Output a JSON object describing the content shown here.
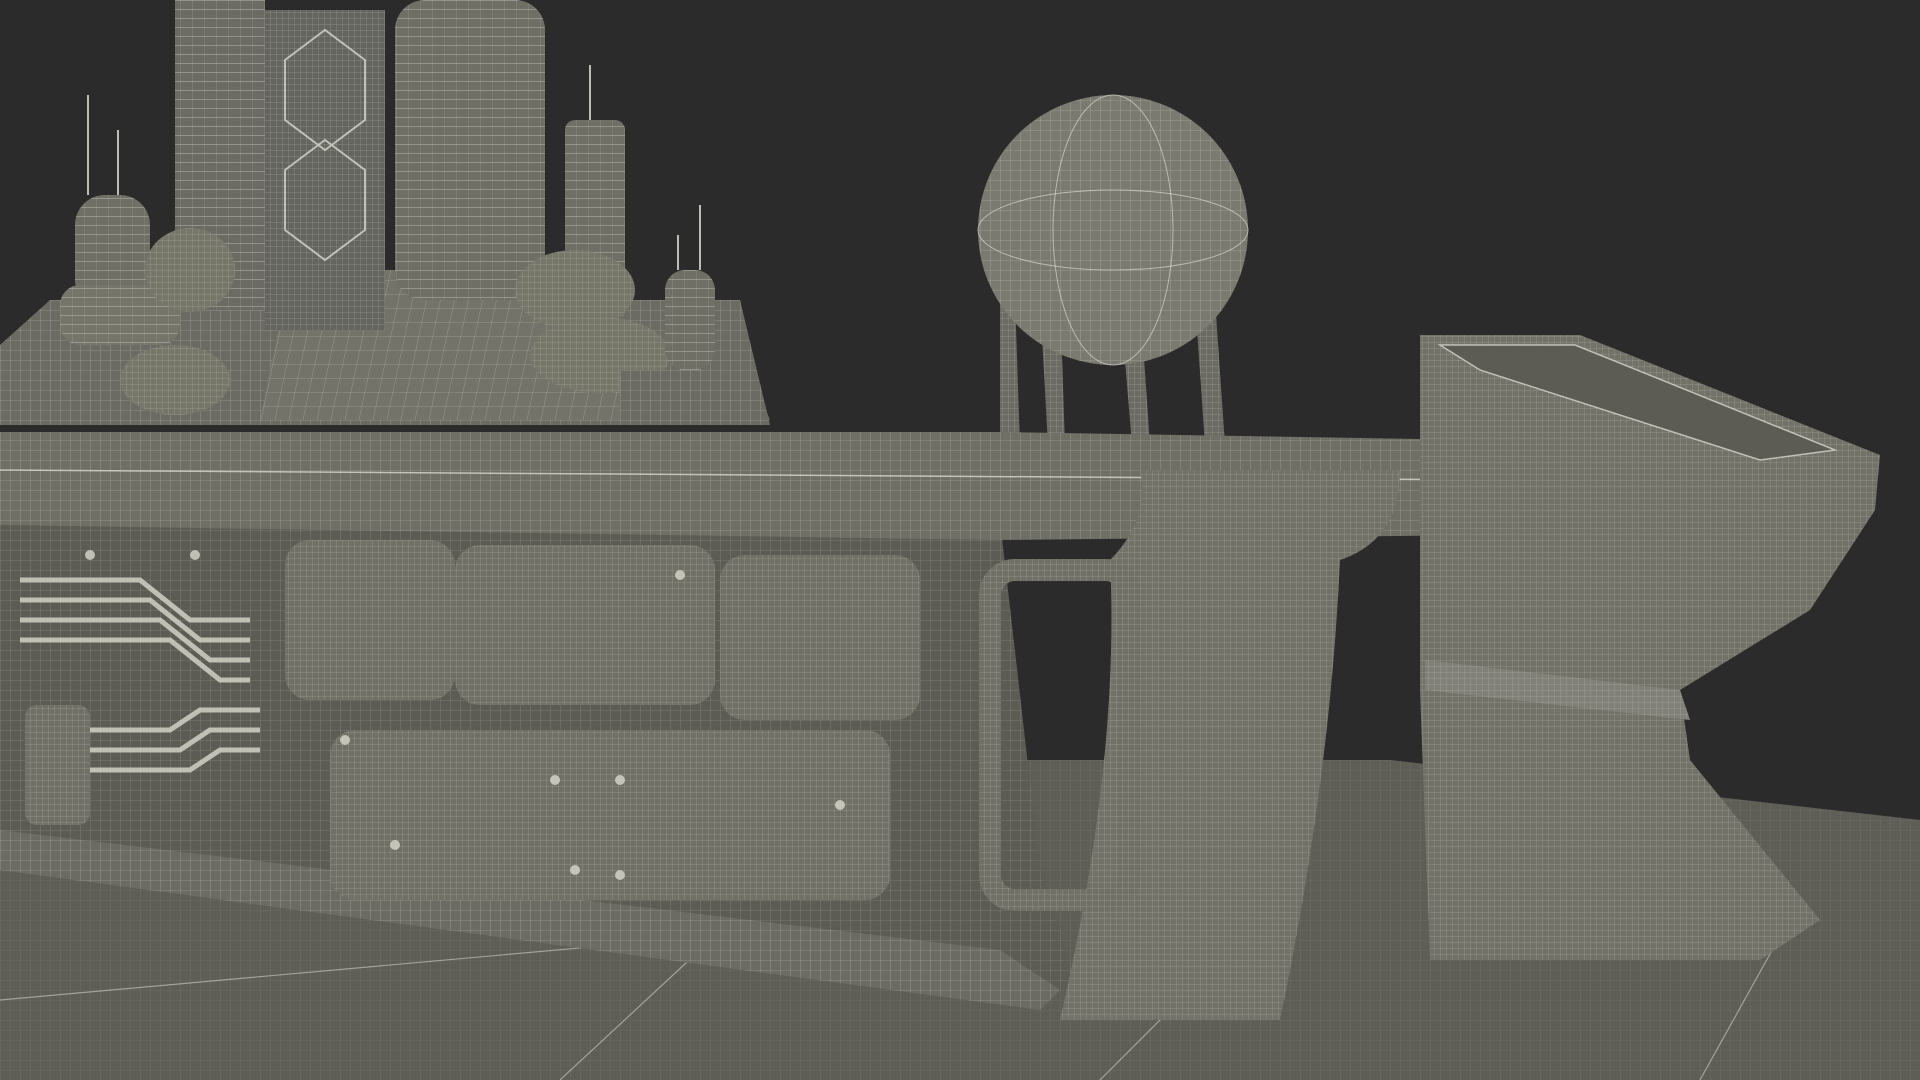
{
  "scene": {
    "subject": "",
    "colors": {
      "background": "#2b2b2b",
      "surface": "#6b6b63",
      "surface_light": "#808078",
      "surface_dark": "#55554e",
      "floor": "#5e5e57",
      "wire": "#e6e6dc"
    }
  }
}
